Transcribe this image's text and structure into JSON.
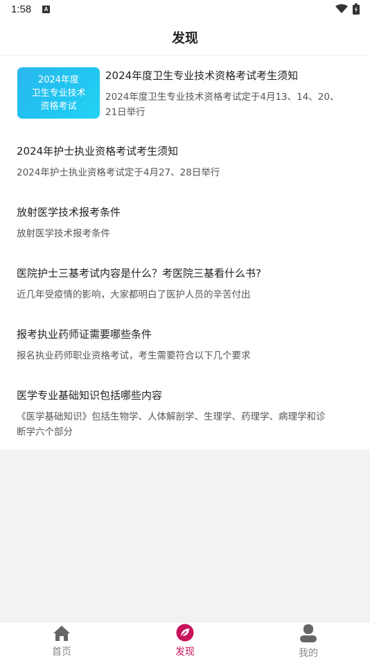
{
  "status": {
    "time": "1:58",
    "notification_badge": "A"
  },
  "header": {
    "title": "发现"
  },
  "articles": [
    {
      "title": "2024年度卫生专业技术资格考试考生须知",
      "desc_line1": "2024年度卫生专业技术资格考试定于4月13、14、20、",
      "desc_line2": "21日举行",
      "thumb_lines": [
        "2024年度",
        "卫生专业技术",
        "资格考试"
      ]
    },
    {
      "title": "2024年护士执业资格考试考生须知",
      "desc": "2024年护士执业资格考试定于4月27、28日举行"
    },
    {
      "title": "放射医学技术报考条件",
      "desc": "放射医学技术报考条件"
    },
    {
      "title": "医院护士三基考试内容是什么？考医院三基看什么书?",
      "desc": "近几年受疫情的影响，大家都明白了医护人员的辛苦付出"
    },
    {
      "title": "报考执业药师证需要哪些条件",
      "desc": "报名执业药师职业资格考试，考生需要符合以下几个要求"
    },
    {
      "title": "医学专业基础知识包括哪些内容",
      "desc_line1": "《医学基础知识》包括生物学、人体解剖学、生理学、药理学、病理学和诊",
      "desc_line2": "断学六个部分"
    }
  ],
  "tabbar": {
    "items": [
      {
        "label": "首页",
        "icon": "home-icon",
        "active": false
      },
      {
        "label": "发现",
        "icon": "leaf-icon",
        "active": true
      },
      {
        "label": "我的",
        "icon": "user-icon",
        "active": false
      }
    ],
    "active_color": "#c8125a",
    "inactive_color": "#888888"
  }
}
